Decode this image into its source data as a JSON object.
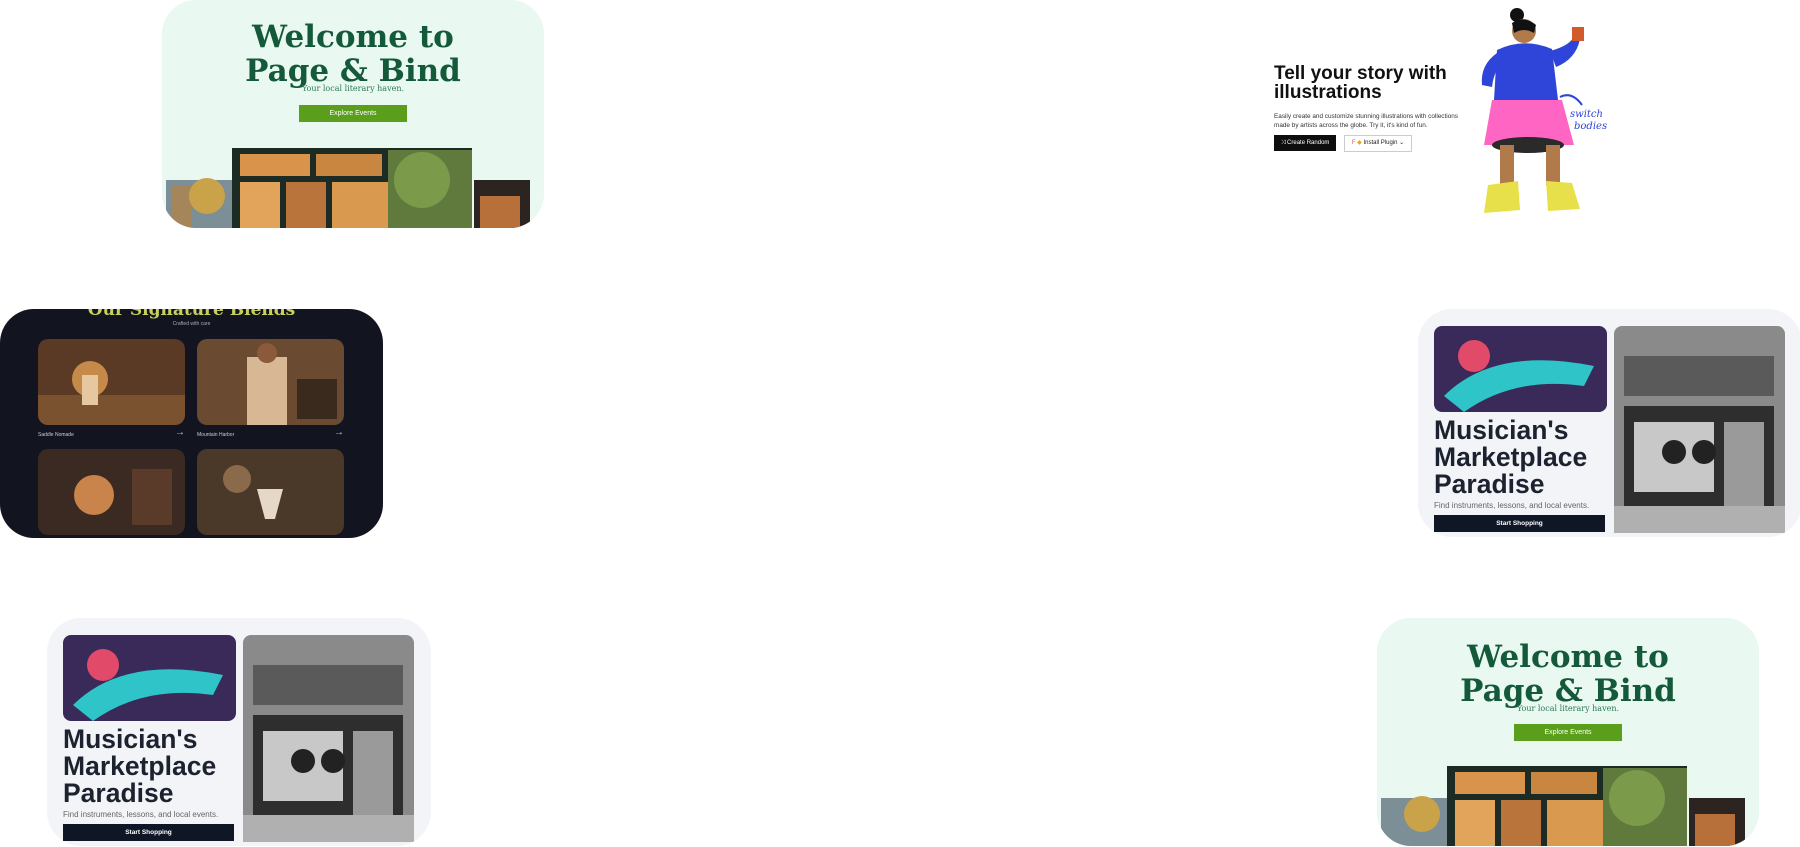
{
  "page_bind": {
    "title_line1": "Welcome to",
    "title_line2": "Page & Bind",
    "tagline": "Your local literary haven.",
    "cta": "Explore Events"
  },
  "illustrations": {
    "heading": "Tell your story with illustrations",
    "body": "Easily create and customize stunning illustrations with collections made by artists across the globe. Try it, it's kind of fun.",
    "primary_button": "Create Random",
    "secondary_button": "Install Plugin",
    "annotation": "switch bodies"
  },
  "coffee": {
    "title": "Our Signature Blends",
    "subtitle": "Crafted with care",
    "items": [
      {
        "label": "Saddle Nomade"
      },
      {
        "label": "Mountain Harbor"
      }
    ]
  },
  "musician": {
    "heading_line1": "Musician's",
    "heading_line2": "Marketplace",
    "heading_line3": "Paradise",
    "description": "Find instruments, lessons, and local events.",
    "cta": "Start Shopping"
  },
  "colors": {
    "pb_bg": "#e9f8f0",
    "pb_title": "#145a3a",
    "pb_button": "#5a9e1c",
    "coffee_bg": "#121420",
    "musician_button": "#0f1626"
  }
}
